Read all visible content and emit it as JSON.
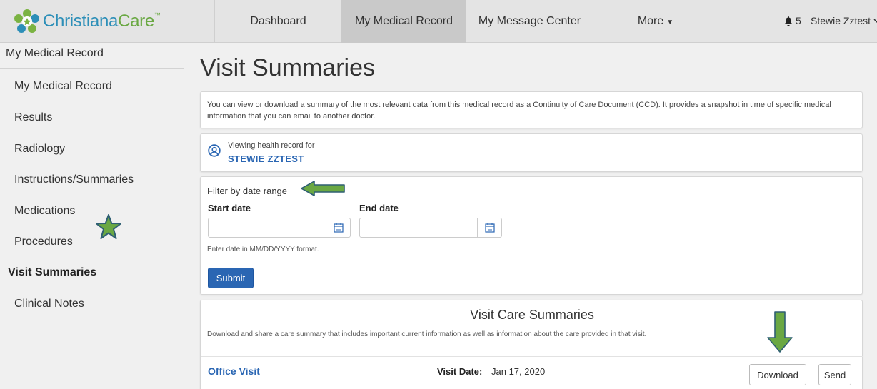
{
  "brand": {
    "name_part1": "Christiana",
    "name_part2": "Care",
    "trademark": "™"
  },
  "nav": {
    "items": [
      {
        "label": "Dashboard"
      },
      {
        "label": "My Medical Record"
      },
      {
        "label": "My Message Center"
      },
      {
        "label": "More"
      }
    ],
    "notification_count": "5",
    "user_name": "Stewie Zztest"
  },
  "sidebar": {
    "header": "My Medical Record",
    "items": [
      {
        "label": "My Medical Record"
      },
      {
        "label": "Results"
      },
      {
        "label": "Radiology"
      },
      {
        "label": "Instructions/Summaries"
      },
      {
        "label": "Medications"
      },
      {
        "label": "Procedures"
      },
      {
        "label": "Visit Summaries"
      },
      {
        "label": "Clinical Notes"
      }
    ]
  },
  "main": {
    "title": "Visit Summaries",
    "info_text": "You can view or download a summary of the most relevant data from this medical record as a Continuity of Care Document (CCD).  It provides a snapshot in time of specific medical information that you can email to another doctor.",
    "viewing_label": "Viewing health record for",
    "viewing_name": "STEWIE ZZTEST",
    "filter": {
      "label": "Filter by date range",
      "start_label": "Start date",
      "end_label": "End date",
      "start_value": "",
      "end_value": "",
      "help_text": "Enter date in MM/DD/YYYY format.",
      "submit_label": "Submit"
    },
    "care": {
      "title": "Visit Care Summaries",
      "description": "Download and share a care summary that includes important current information as well as information about the care provided in that visit.",
      "visits": [
        {
          "type": "Office Visit",
          "date_label": "Visit Date:",
          "date": "Jan 17, 2020",
          "download_label": "Download",
          "send_label": "Send"
        }
      ]
    }
  },
  "colors": {
    "accent": "#2a66b3",
    "annotation_green": "#6aa843",
    "annotation_border": "#2f5f73"
  }
}
